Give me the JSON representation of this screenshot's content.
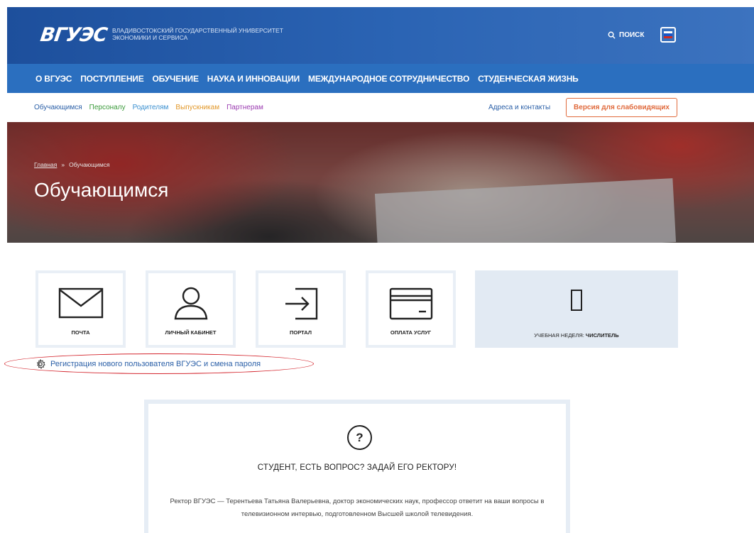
{
  "header": {
    "logo": "ВГУЭС",
    "university_name": "ВЛАДИВОСТОКСКИЙ ГОСУДАРСТВЕННЫЙ УНИВЕРСИТЕТ ЭКОНОМИКИ И СЕРВИСА",
    "search_label": "ПОИСК",
    "flag_colors": [
      "#ffffff",
      "#1c57c7",
      "#d52b1e"
    ]
  },
  "nav": {
    "items": [
      "О ВГУЭС",
      "ПОСТУПЛЕНИЕ",
      "ОБУЧЕНИЕ",
      "НАУКА И ИННОВАЦИИ",
      "МЕЖДУНАРОДНОЕ СОТРУДНИЧЕСТВО",
      "СТУДЕНЧЕСКАЯ ЖИЗНЬ"
    ]
  },
  "subnav": {
    "links": [
      {
        "label": "Обучающимся",
        "color": "#2a5fa7"
      },
      {
        "label": "Персоналу",
        "color": "#3a9a3a"
      },
      {
        "label": "Родителям",
        "color": "#3a8fd0"
      },
      {
        "label": "Выпускникам",
        "color": "#e2982a"
      },
      {
        "label": "Партнерам",
        "color": "#9a3ab0"
      }
    ],
    "addresses": "Адреса и контакты",
    "vision_button": "Версия для слабовидящих"
  },
  "hero": {
    "breadcrumb_home": "Главная",
    "breadcrumb_sep": "»",
    "breadcrumb_current": "Обучающимся",
    "title": "Обучающимся"
  },
  "tiles": [
    {
      "label": "ПОЧТА",
      "icon": "mail-icon"
    },
    {
      "label": "ЛИЧНЫЙ КАБИНЕТ",
      "icon": "user-icon"
    },
    {
      "label": "ПОРТАЛ",
      "icon": "login-icon"
    },
    {
      "label": "ОПЛАТА УСЛУГ",
      "icon": "card-icon"
    }
  ],
  "week": {
    "label": "УЧЕБНАЯ НЕДЕЛЯ:",
    "value": "ЧИСЛИТЕЛЬ"
  },
  "registration": {
    "label": "Регистрация нового пользователя ВГУЭС и смена пароля"
  },
  "question": {
    "icon_glyph": "?",
    "title": "СТУДЕНТ, ЕСТЬ ВОПРОС? ЗАДАЙ ЕГО РЕКТОРУ!",
    "text": "Ректор ВГУЭС — Терентьева Татьяна Валерьевна, доктор экономических наук, профессор ответит на ваши вопросы в телевизионном интервью, подготовленном Высшей школой телевидения."
  }
}
